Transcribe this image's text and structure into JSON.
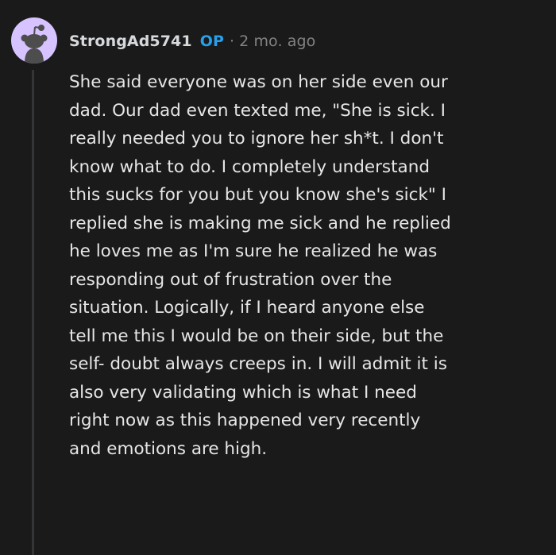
{
  "comment": {
    "author": "StrongAd5741",
    "op_badge": "OP",
    "separator": "·",
    "timestamp": "2 mo. ago",
    "avatar_icon": "snoo-avatar-icon",
    "colors": {
      "background": "#1a1a1b",
      "avatar_background": "#d7c3ff",
      "op_badge": "#24a0ed",
      "meta_text": "#818384",
      "body_text": "#e6e6e6"
    },
    "body_lines": [
      "She said everyone was on her side even our",
      "dad. Our dad even texted me, \"She is sick. I",
      "really needed you to ignore her sh*t. I don't",
      "know what to do. I completely understand",
      "this sucks for you but you know she's sick\" I",
      "replied she is making me sick and he replied",
      "he loves me as I'm sure he realized he was",
      "responding out of frustration over the",
      "situation. Logically, if I heard anyone else",
      "tell me this I would be on their side, but the",
      "self- doubt always creeps in. I will admit it is",
      "also very validating which is what I need",
      "right now as this happened very recently",
      "and emotions are high."
    ]
  }
}
